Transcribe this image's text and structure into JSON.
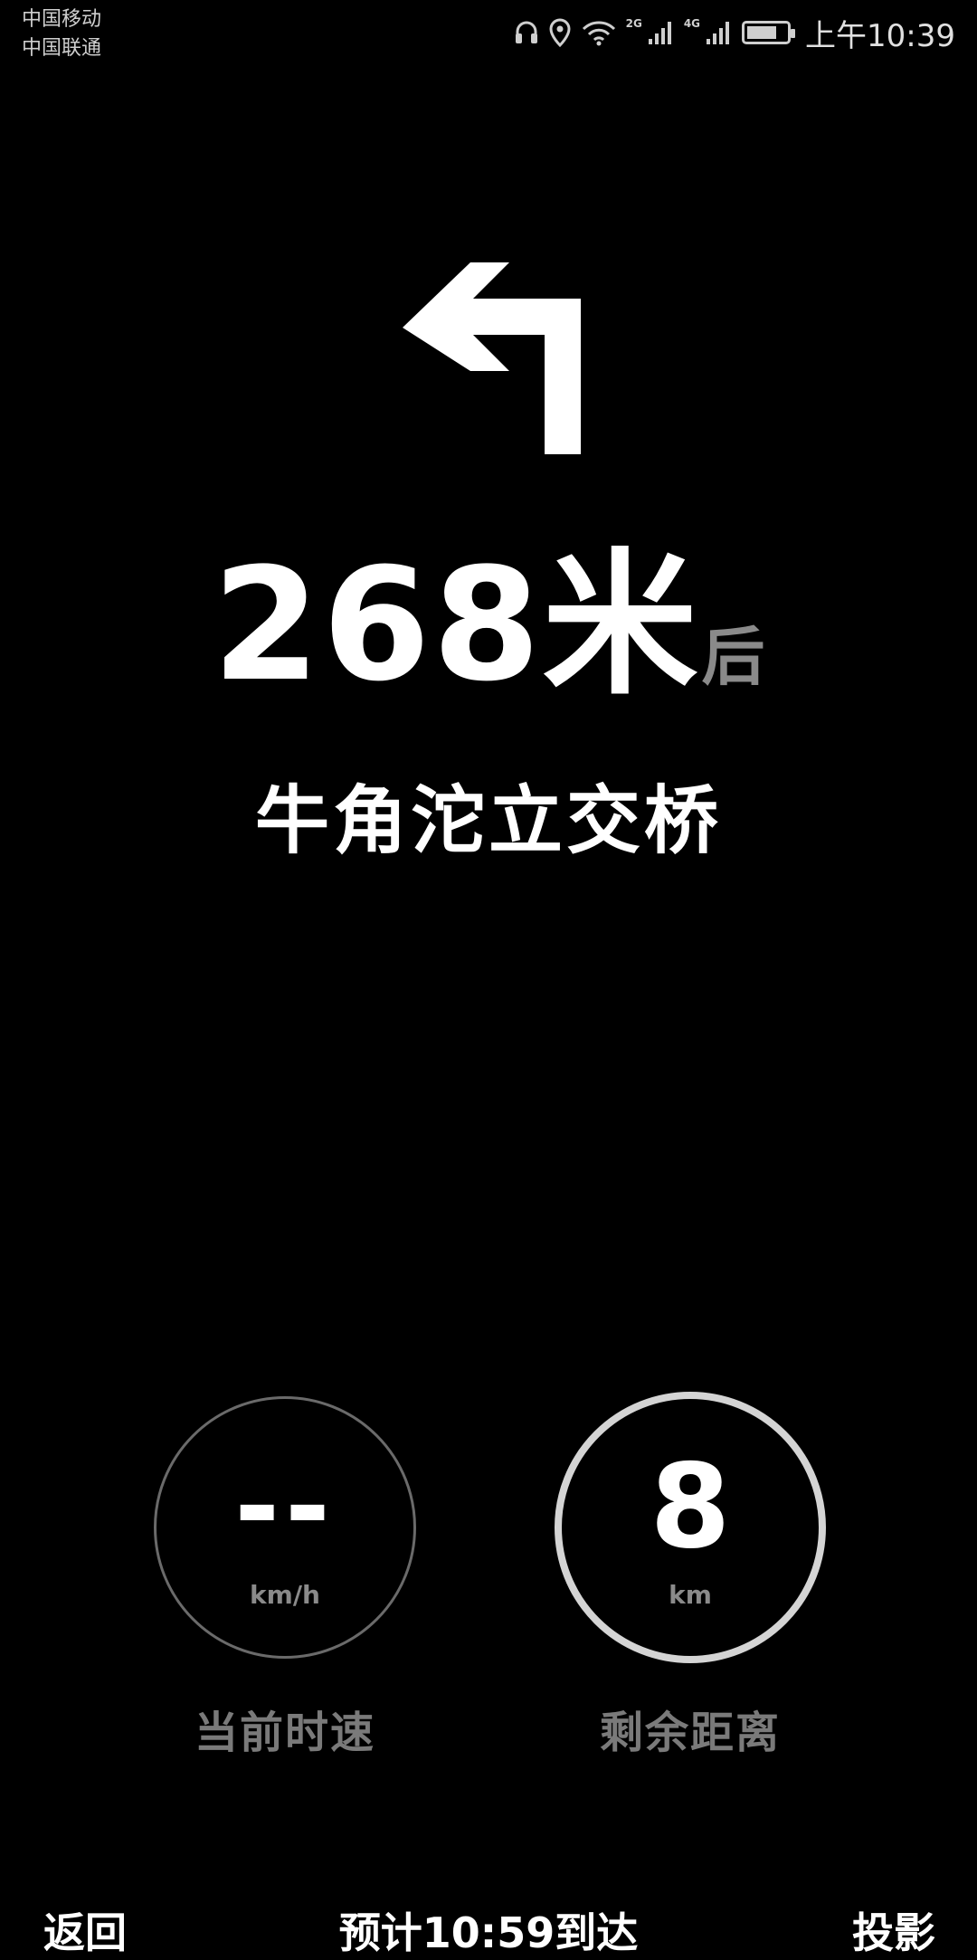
{
  "status_bar": {
    "carrier_1": "中国移动",
    "carrier_2": "中国联通",
    "network_badge_1": "2G",
    "network_badge_2": "4G",
    "time": "上午10:39",
    "icons": [
      "headset-icon",
      "location-icon",
      "wifi-icon",
      "signal-icon",
      "signal-icon",
      "battery-icon"
    ],
    "battery_level": 0.75
  },
  "navigation": {
    "turn_icon": "turn-left-arrow-icon",
    "distance_number": "268",
    "distance_unit": "米",
    "distance_suffix": "后",
    "road_name": "牛角沱立交桥"
  },
  "gauges": {
    "speed": {
      "value": "--",
      "unit": "km/h",
      "caption": "当前时速"
    },
    "remaining": {
      "value": "8",
      "unit": "km",
      "caption": "剩余距离"
    }
  },
  "bottom_bar": {
    "back_label": "返回",
    "eta_text": "预计10:59到达",
    "cast_label": "投影"
  },
  "colors": {
    "background": "#000000",
    "primary_text": "#ffffff",
    "secondary_text": "#8a8a8a",
    "speed_ring": "#6a6a6a",
    "distance_ring": "#d4d4d4"
  }
}
